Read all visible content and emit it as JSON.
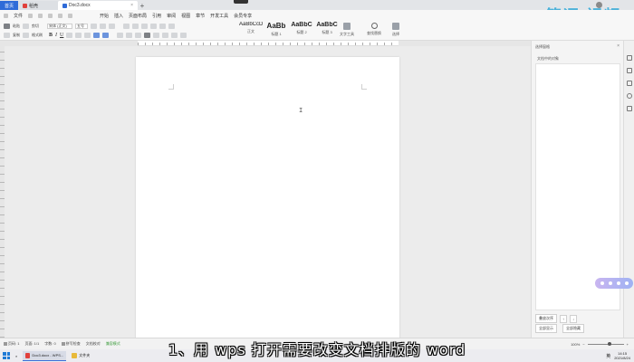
{
  "tabs": [
    {
      "label": "首页"
    },
    {
      "label": "稻壳"
    },
    {
      "label": "Doc3.docx"
    }
  ],
  "watermark": "简词·视频",
  "menu": {
    "file": "文件",
    "items": [
      "开始",
      "插入",
      "页面布局",
      "引用",
      "审阅",
      "视图",
      "章节",
      "开发工具",
      "会员专享"
    ],
    "active": "开始"
  },
  "toolbar": {
    "paste": "粘贴",
    "cut": "剪切",
    "copy": "复制",
    "format_painter": "格式刷",
    "font_name": "宋体 (正文)",
    "font_size": "五号",
    "bold": "B",
    "italic": "I",
    "underline": "U"
  },
  "styles": [
    {
      "preview": "AaBbCcDd",
      "name": "正文"
    },
    {
      "preview": "AaBb",
      "name": "标题 1"
    },
    {
      "preview": "AaBbC",
      "name": "标题 2"
    },
    {
      "preview": "AaBbC",
      "name": "标题 3"
    }
  ],
  "tools": {
    "text_tools": "文字工具",
    "find_replace": "查找替换",
    "select": "选择"
  },
  "cursor_glyph": "I",
  "right_panel": {
    "header": "选择窗格",
    "subtitle": "文档中的对象",
    "order_label": "叠放次序",
    "show_all": "全部显示",
    "hide_all": "全部隐藏"
  },
  "statusbar": {
    "page": "页码: 1",
    "pages": "页面: 1/1",
    "words": "字数: 0",
    "spell": "拼写检查",
    "text_check": "文档校对",
    "compat": "兼容模式",
    "zoom": "100%"
  },
  "taskbar": {
    "app_label": "Doc3.docx - WPS...",
    "folder_label": "文件夹",
    "ime": "英",
    "time": "14:15",
    "date": "2021/8/24"
  },
  "subtitle": "1、用 wps 打开需要改变文档排版的 word"
}
